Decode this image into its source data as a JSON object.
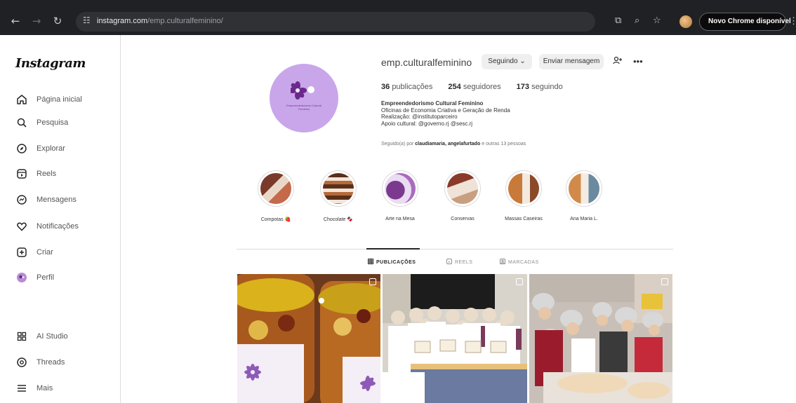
{
  "browser": {
    "url_host": "instagram.com",
    "url_path": "/emp.culturalfeminino/",
    "update_button": "Novo Chrome disponível"
  },
  "sidebar": {
    "logo": "Instagram",
    "items": [
      {
        "label": "Página inicial",
        "icon": "home-icon"
      },
      {
        "label": "Pesquisa",
        "icon": "search-icon"
      },
      {
        "label": "Explorar",
        "icon": "compass-icon"
      },
      {
        "label": "Reels",
        "icon": "reels-icon"
      },
      {
        "label": "Mensagens",
        "icon": "messenger-icon"
      },
      {
        "label": "Notificações",
        "icon": "heart-icon"
      },
      {
        "label": "Criar",
        "icon": "plus-square-icon"
      },
      {
        "label": "Perfil",
        "icon": "profile-avatar-icon"
      }
    ],
    "bottom_items": [
      {
        "label": "AI Studio",
        "icon": "ai-studio-icon"
      },
      {
        "label": "Threads",
        "icon": "threads-icon"
      },
      {
        "label": "Mais",
        "icon": "menu-icon"
      }
    ]
  },
  "profile": {
    "username": "emp.culturalfeminino",
    "following_button": "Seguindo",
    "message_button": "Enviar mensagem",
    "posts_count": "36",
    "posts_label": "publicações",
    "followers_count": "254",
    "followers_label": "seguidores",
    "following_count": "173",
    "following_label": "seguindo",
    "bio": {
      "name": "Empreendedorismo Cultural Feminino",
      "line1": "Oficinas de Economia Criativa e Geração de Renda",
      "line2": "Realização: @institutoparceiro",
      "line3": "Apoio cultural: @governo.rj @sesc.rj"
    },
    "followed_by_prefix": "Seguido(a) por",
    "followed_by_names": "claudiamaria, angelafurtado",
    "followed_by_suffix": "e outras 13 pessoas"
  },
  "highlights": [
    {
      "label": "Compotas 🍓"
    },
    {
      "label": "Chocolate 🍫"
    },
    {
      "label": "Arte na Mesa"
    },
    {
      "label": "Conservas"
    },
    {
      "label": "Massas Caseiras"
    },
    {
      "label": "Ana Maria L."
    }
  ],
  "tabs": [
    {
      "label": "PUBLICAÇÕES",
      "icon": "grid-icon",
      "active": true
    },
    {
      "label": "REELS",
      "icon": "reels-icon",
      "active": false
    },
    {
      "label": "MARCADAS",
      "icon": "tagged-icon",
      "active": false
    }
  ],
  "posts": [
    {
      "alt": "Potes de compota com rótulo de flor roxa"
    },
    {
      "alt": "Grupo de mulheres com aventais e certificados"
    },
    {
      "alt": "Oficina de culinária com participantes de toucas"
    }
  ],
  "colors": {
    "profile_pic_bg": "#c9a6ea",
    "brand_purple": "#8e44ad",
    "chrome_bg": "#202124"
  }
}
